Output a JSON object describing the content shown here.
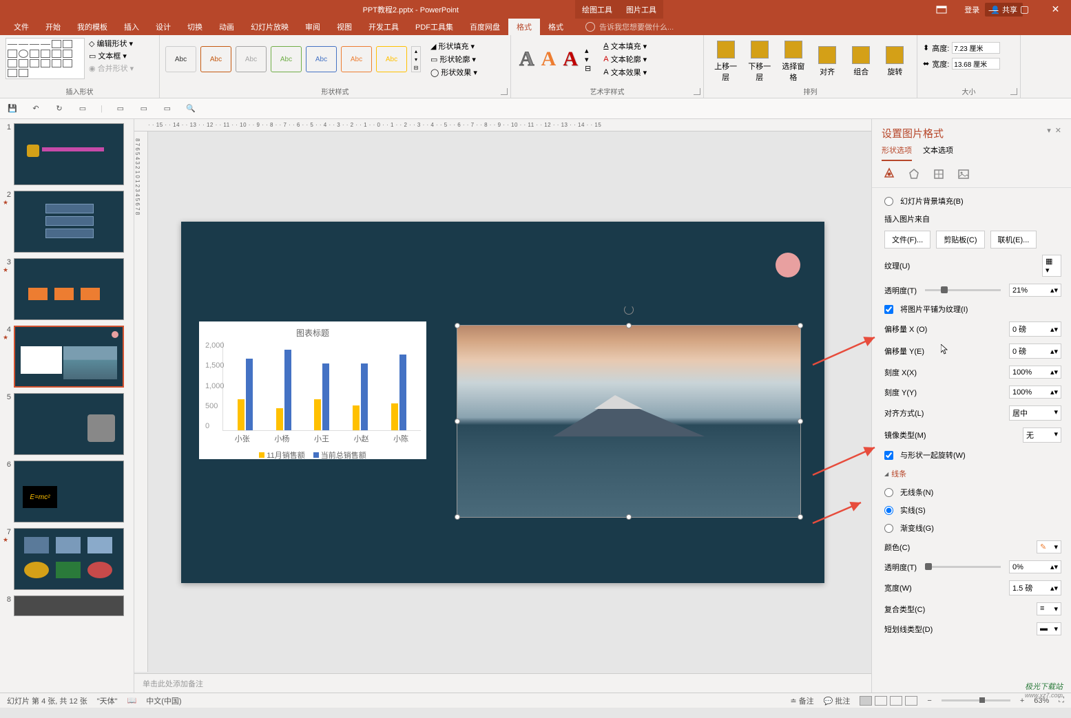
{
  "app": {
    "title": "PPT教程2.pptx - PowerPoint",
    "tool_tab1": "绘图工具",
    "tool_tab2": "图片工具"
  },
  "window": {
    "login": "登录",
    "share": "共享"
  },
  "tabs": {
    "file": "文件",
    "home": "开始",
    "template": "我的模板",
    "insert": "插入",
    "design": "设计",
    "transition": "切换",
    "animation": "动画",
    "slideshow": "幻灯片放映",
    "review": "审阅",
    "view": "视图",
    "developer": "开发工具",
    "pdf": "PDF工具集",
    "baidu": "百度网盘",
    "format1": "格式",
    "format2": "格式",
    "tellme": "告诉我您想要做什么..."
  },
  "ribbon": {
    "insert_shape": {
      "edit_shape": "编辑形状",
      "text_box": "文本框",
      "merge": "合并形状",
      "group": "插入形状"
    },
    "shape_style": {
      "abc": "Abc",
      "fill": "形状填充",
      "outline": "形状轮廓",
      "effects": "形状效果",
      "group": "形状样式"
    },
    "wordart": {
      "text_fill": "文本填充",
      "text_outline": "文本轮廓",
      "text_effects": "文本效果",
      "group": "艺术字样式"
    },
    "arrange": {
      "bring_forward": "上移一层",
      "send_backward": "下移一层",
      "selection_pane": "选择窗格",
      "align": "对齐",
      "group_btn": "组合",
      "rotate": "旋转",
      "group": "排列"
    },
    "size": {
      "height": "高度:",
      "height_val": "7.23 厘米",
      "width": "宽度:",
      "width_val": "13.68 厘米",
      "group": "大小"
    }
  },
  "slide": {
    "chart_title": "图表标题",
    "legend1": "11月销售额",
    "legend2": "当前总销售额",
    "categories": [
      "小张",
      "小杨",
      "小王",
      "小赵",
      "小陈"
    ]
  },
  "chart_data": {
    "type": "bar",
    "title": "图表标题",
    "categories": [
      "小张",
      "小杨",
      "小王",
      "小赵",
      "小陈"
    ],
    "series": [
      {
        "name": "11月销售额",
        "color": "#ffc000",
        "values": [
          700,
          500,
          700,
          550,
          600
        ]
      },
      {
        "name": "当前总销售额",
        "color": "#4472c4",
        "values": [
          1600,
          1800,
          1500,
          1500,
          1700
        ]
      }
    ],
    "ylim": [
      0,
      2000
    ],
    "y_ticks": [
      0,
      500,
      1000,
      1500,
      2000
    ],
    "xlabel": "",
    "ylabel": ""
  },
  "notes": {
    "placeholder": "单击此处添加备注"
  },
  "panel": {
    "title": "设置图片格式",
    "tab_shape": "形状选项",
    "tab_text": "文本选项",
    "slide_bg_fill": "幻灯片背景填充(B)",
    "insert_from": "插入图片来自",
    "btn_file": "文件(F)...",
    "btn_clipboard": "剪贴板(C)",
    "btn_online": "联机(E)...",
    "texture": "纹理(U)",
    "transparency": "透明度(T)",
    "transparency_val": "21%",
    "tile": "将图片平铺为纹理(I)",
    "offset_x": "偏移量 X (O)",
    "offset_x_val": "0 磅",
    "offset_y": "偏移量 Y(E)",
    "offset_y_val": "0 磅",
    "scale_x": "刻度 X(X)",
    "scale_x_val": "100%",
    "scale_y": "刻度 Y(Y)",
    "scale_y_val": "100%",
    "alignment": "对齐方式(L)",
    "alignment_val": "居中",
    "mirror": "镜像类型(M)",
    "mirror_val": "无",
    "rotate_with": "与形状一起旋转(W)",
    "section_line": "线条",
    "no_line": "无线条(N)",
    "solid_line": "实线(S)",
    "gradient_line": "渐变线(G)",
    "color": "颜色(C)",
    "transparency2": "透明度(T)",
    "transparency2_val": "0%",
    "width": "宽度(W)",
    "width_val": "1.5 磅",
    "compound": "复合类型(C)",
    "dash": "短划线类型(D)"
  },
  "status": {
    "slide_info": "幻灯片 第 4 张, 共 12 张",
    "lang": "\"天体\"",
    "chinese": "中文(中国)",
    "notes": "备注",
    "comments": "批注",
    "zoom": "63%"
  },
  "watermark": {
    "line1": "极光下载站",
    "line2": "www.xz7.com"
  }
}
